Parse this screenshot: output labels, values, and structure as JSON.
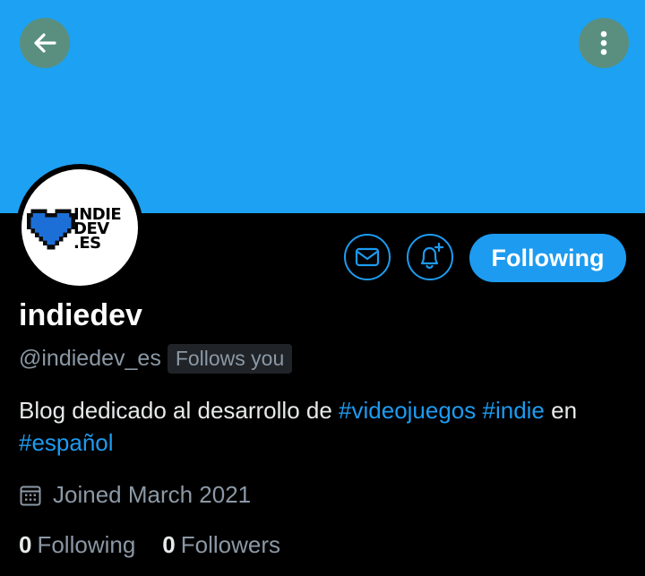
{
  "header": {
    "back_icon": "arrow-left-icon",
    "more_icon": "more-vertical-icon",
    "banner_color": "#1da1f2"
  },
  "avatar": {
    "logo_lines": [
      "INDIE",
      "DEV",
      ".ES"
    ],
    "heart_color": "#1d6fd8"
  },
  "actions": {
    "message_icon": "mail-icon",
    "notify_icon": "bell-plus-icon",
    "following_label": "Following",
    "accent": "#1d9bf0"
  },
  "profile": {
    "name": "indiedev",
    "handle": "@indiedev_es",
    "follows_you": "Follows you",
    "bio": {
      "part1": "Blog dedicado al desarrollo de ",
      "tag1": "#videojuegos",
      "space": " ",
      "tag2": "#indie",
      "part2": " en ",
      "tag3": "#español"
    },
    "joined": "Joined March 2021",
    "joined_icon": "calendar-icon"
  },
  "stats": {
    "following_count": "0",
    "following_label": "Following",
    "followers_count": "0",
    "followers_label": "Followers"
  }
}
